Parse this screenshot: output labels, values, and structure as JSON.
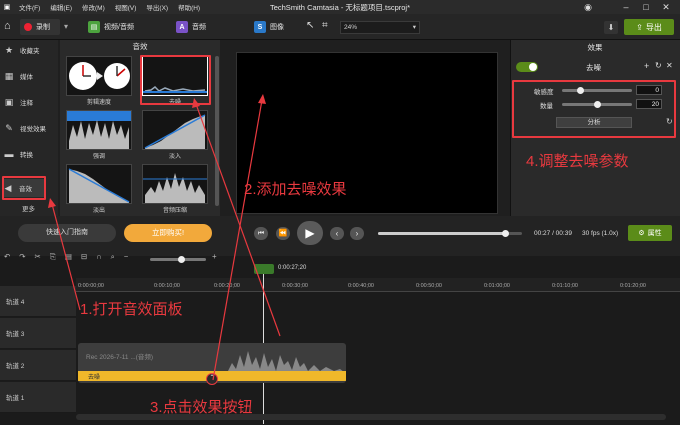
{
  "app": {
    "title": "TechSmith Camtasia - 无标题项目.tscproj*"
  },
  "menu": [
    "文件(F)",
    "编辑(E)",
    "修改(M)",
    "视图(V)",
    "导出(X)",
    "帮助(H)"
  ],
  "toolbar": {
    "record": "录制",
    "tabs": [
      "视频/音频",
      "音频",
      "图像"
    ],
    "zoom": "24%",
    "export": "导出"
  },
  "sidebar": [
    "收藏夹",
    "媒体",
    "注释",
    "视觉效果",
    "转换",
    "音效"
  ],
  "sidebar_more": "更多",
  "effects_panel": {
    "title": "音效",
    "items": [
      "剪辑速度",
      "去噪",
      "强调",
      "淡入",
      "淡出",
      "音频压缩"
    ]
  },
  "props": {
    "title": "效果",
    "effect_name": "去噪",
    "sensitivity_label": "敏感度",
    "sensitivity_value": "0",
    "amount_label": "数量",
    "amount_value": "20",
    "analyze": "分析",
    "sensitivity_level": 0.25,
    "amount_level": 0.5
  },
  "playback": {
    "guide": "快速入门指南",
    "buy": "立即购买!",
    "time": "00:27 / 00:39",
    "fps": "30 fps (1.0x)",
    "properties": "属性",
    "progress": 0.88
  },
  "timeline": {
    "playhead": "0:00:27;20",
    "ticks": [
      "0:00:00;00",
      "0:00:10;00",
      "0:00:20;00",
      "0:00:30;00",
      "0:00:40;00",
      "0:00:50;00",
      "0:01:00;00",
      "0:01:10;00",
      "0:01:20;00"
    ],
    "tracks": [
      "轨道 4",
      "轨道 3",
      "轨道 2",
      "轨道 1"
    ],
    "clip_label": "Rec 2026-7-11 ...(音频)",
    "clip_effect": "去噪"
  },
  "annotations": [
    "1.打开音效面板",
    "2.添加去噪效果",
    "3.点击效果按钮",
    "4.调整去噪参数"
  ],
  "colors": {
    "accent_green": "#5b8c19",
    "highlight_red": "#e8393f",
    "clip_yellow": "#f0b82a",
    "buy_orange": "#f2a93b"
  }
}
